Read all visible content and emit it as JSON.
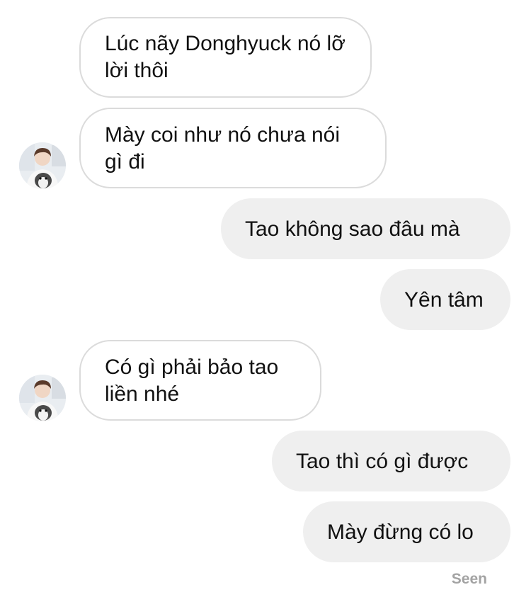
{
  "thread": {
    "messages": [
      {
        "direction": "incoming",
        "text": "Lúc nãy Donghyuck nó lỡ lời thôi"
      },
      {
        "direction": "incoming",
        "text": "Mày coi như nó chưa nói gì đi"
      },
      {
        "direction": "outgoing",
        "text": "Tao không sao đâu mà"
      },
      {
        "direction": "outgoing",
        "text": "Yên tâm"
      },
      {
        "direction": "incoming",
        "text": "Có gì phải bảo tao liền nhé"
      },
      {
        "direction": "outgoing",
        "text": "Tao thì có gì được"
      },
      {
        "direction": "outgoing",
        "text": "Mày đừng có lo"
      }
    ],
    "seen_label": "Seen"
  },
  "colors": {
    "incoming_bubble_bg": "#ffffff",
    "incoming_bubble_border": "#dbdbdb",
    "outgoing_bubble_bg": "#efefef",
    "text": "#111111",
    "seen_text": "#a3a3a3"
  }
}
